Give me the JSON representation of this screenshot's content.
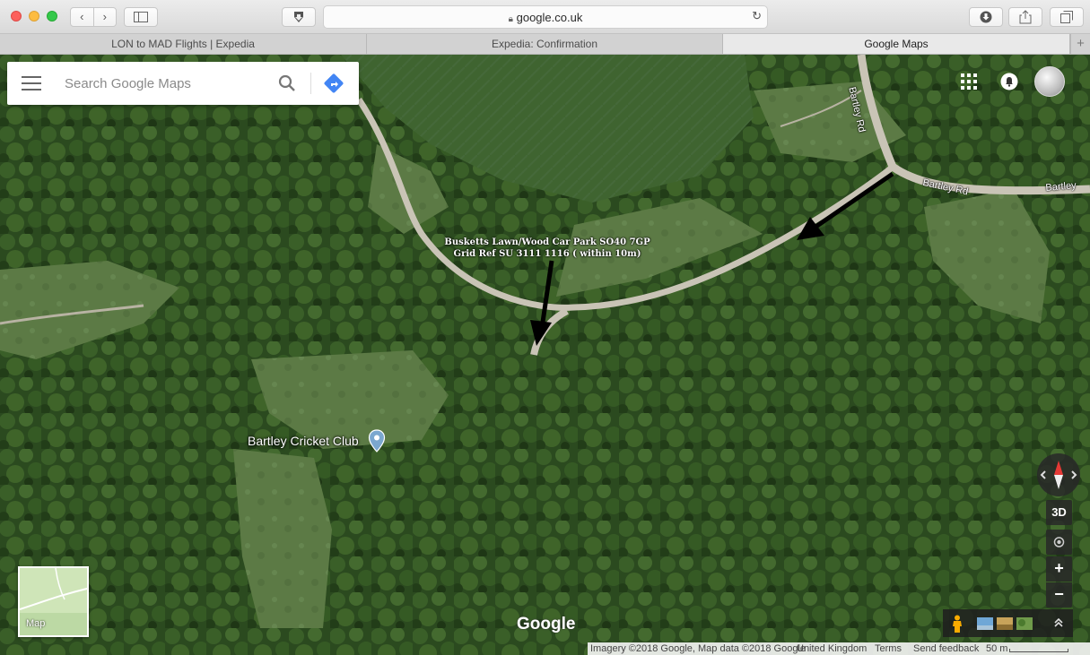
{
  "browser": {
    "address": "google.co.uk",
    "tabs": [
      {
        "label": "LON to MAD Flights | Expedia",
        "active": false
      },
      {
        "label": "Expedia: Confirmation",
        "active": false
      },
      {
        "label": "Google Maps",
        "active": true
      }
    ]
  },
  "maps": {
    "search_placeholder": "Search Google Maps",
    "place_label": "Bartley Cricket Club",
    "road_labels": [
      "Bartley Rd",
      "Bartley Rd",
      "Bartley"
    ],
    "annotation": {
      "line1": "Busketts Lawn/Wood Car Park SO40 7GP",
      "line2": "Grid Ref SU 3111 1116 ( within 10m)"
    },
    "controls": {
      "three_d": "3D",
      "zoom_in": "+",
      "zoom_out": "−"
    },
    "layer_toggle_label": "Map",
    "logo": "Google",
    "footer": {
      "imagery": "Imagery ©2018 Google, Map data ©2018 Google",
      "region": "United Kingdom",
      "terms": "Terms",
      "feedback": "Send feedback",
      "scale": "50 m"
    }
  },
  "colors": {
    "accent_blue": "#4285f4",
    "compass_red": "#e53935",
    "foliage_dark": "#27431c",
    "foliage_light": "#4d6f33",
    "road": "#c9c4b6"
  }
}
